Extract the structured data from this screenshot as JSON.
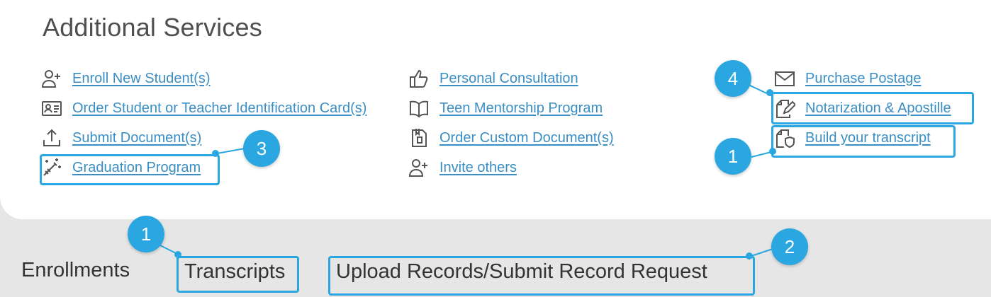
{
  "section_title": "Additional Services",
  "columns": [
    [
      {
        "icon": "user-plus-icon",
        "label": "Enroll New Student(s)"
      },
      {
        "icon": "id-card-icon",
        "label": "Order Student or Teacher Identification Card(s)"
      },
      {
        "icon": "upload-icon",
        "label": "Submit Document(s)"
      },
      {
        "icon": "magic-wand-icon",
        "label": "Graduation Program"
      }
    ],
    [
      {
        "icon": "thumbs-up-icon",
        "label": "Personal Consultation"
      },
      {
        "icon": "book-open-icon",
        "label": "Teen Mentorship Program"
      },
      {
        "icon": "custom-document-icon",
        "label": "Order Custom Document(s)"
      },
      {
        "icon": "user-plus-icon",
        "label": "Invite others"
      }
    ],
    [
      {
        "icon": "envelope-icon",
        "label": "Purchase Postage"
      },
      {
        "icon": "document-pen-icon",
        "label": "Notarization & Apostille"
      },
      {
        "icon": "document-shield-icon",
        "label": "Build your transcript"
      }
    ]
  ],
  "tabs": [
    {
      "label": "Enrollments"
    },
    {
      "label": "Transcripts"
    },
    {
      "label": "Upload Records/Submit Record Request"
    }
  ],
  "badges": [
    "4",
    "3",
    "1",
    "1",
    "2"
  ],
  "colors": {
    "link": "#3a8ec4",
    "accent": "#2aa7e0",
    "panel": "#ffffff",
    "background": "#e6e6e6"
  }
}
